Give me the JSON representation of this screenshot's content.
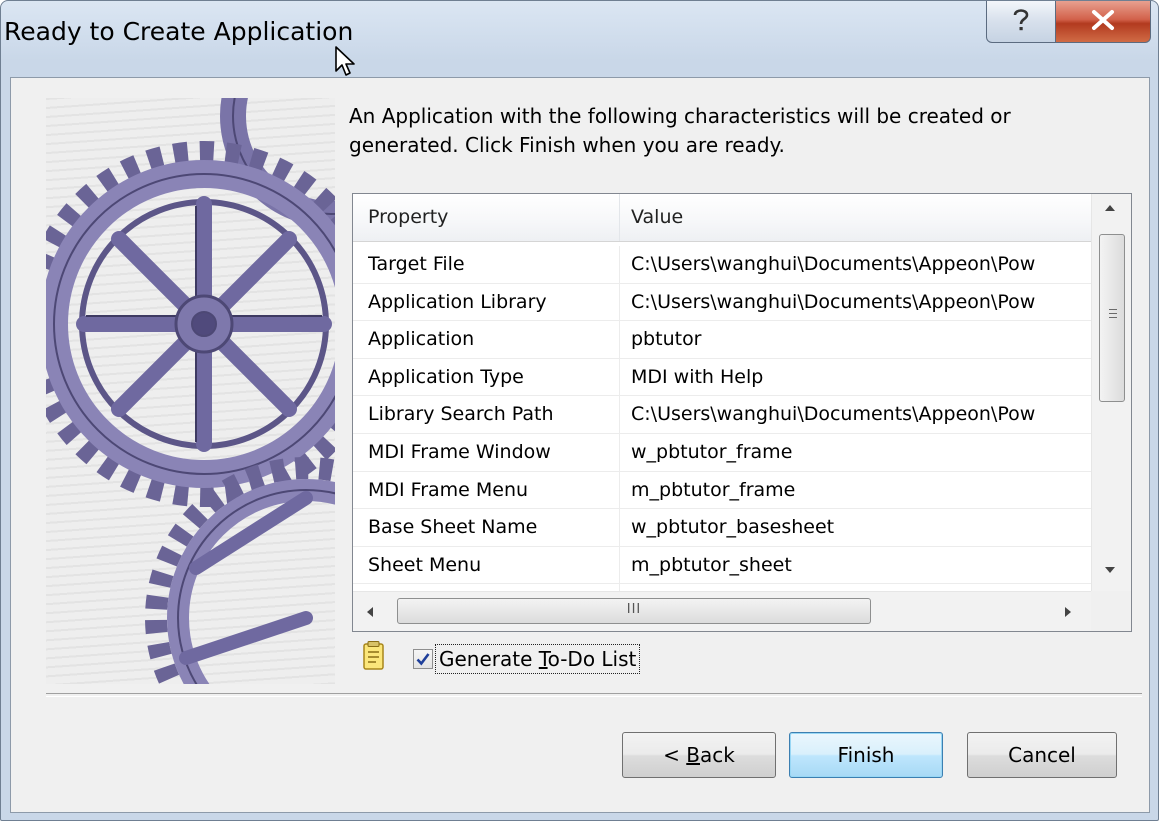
{
  "window": {
    "title": "Ready to Create Application"
  },
  "description": {
    "line1": "An Application with the following characteristics will be created or",
    "line2": "generated.  Click Finish when you are ready."
  },
  "listview": {
    "columns": {
      "property": "Property",
      "value": "Value"
    },
    "rows": [
      {
        "property": "Target File",
        "value": "C:\\Users\\wanghui\\Documents\\Appeon\\Pow"
      },
      {
        "property": "Application Library",
        "value": "C:\\Users\\wanghui\\Documents\\Appeon\\Pow"
      },
      {
        "property": "Application",
        "value": "pbtutor"
      },
      {
        "property": "Application Type",
        "value": "MDI with Help"
      },
      {
        "property": "Library Search Path",
        "value": "C:\\Users\\wanghui\\Documents\\Appeon\\Pow"
      },
      {
        "property": "MDI Frame Window",
        "value": "w_pbtutor_frame"
      },
      {
        "property": "MDI Frame Menu",
        "value": "m_pbtutor_frame"
      },
      {
        "property": "Base Sheet Name",
        "value": "w_pbtutor_basesheet"
      },
      {
        "property": "Sheet Menu",
        "value": "m_pbtutor_sheet"
      }
    ],
    "hscroll_grip": "III"
  },
  "todo": {
    "label_before": "Generate ",
    "label_underlined": "T",
    "label_after": "o-Do List",
    "checked": true
  },
  "buttons": {
    "back_prefix": "< ",
    "back_underlined": "B",
    "back_rest": "ack",
    "finish": "Finish",
    "cancel": "Cancel"
  },
  "colors": {
    "frame": "#c9d7e8",
    "close_button": "#c9462c",
    "finish_button": "#bee6fd",
    "gear": "#6a6496"
  },
  "icons": [
    "help-icon",
    "close-icon",
    "gear-illustration",
    "todo-list-icon",
    "checkmark-icon",
    "mouse-cursor-icon"
  ]
}
